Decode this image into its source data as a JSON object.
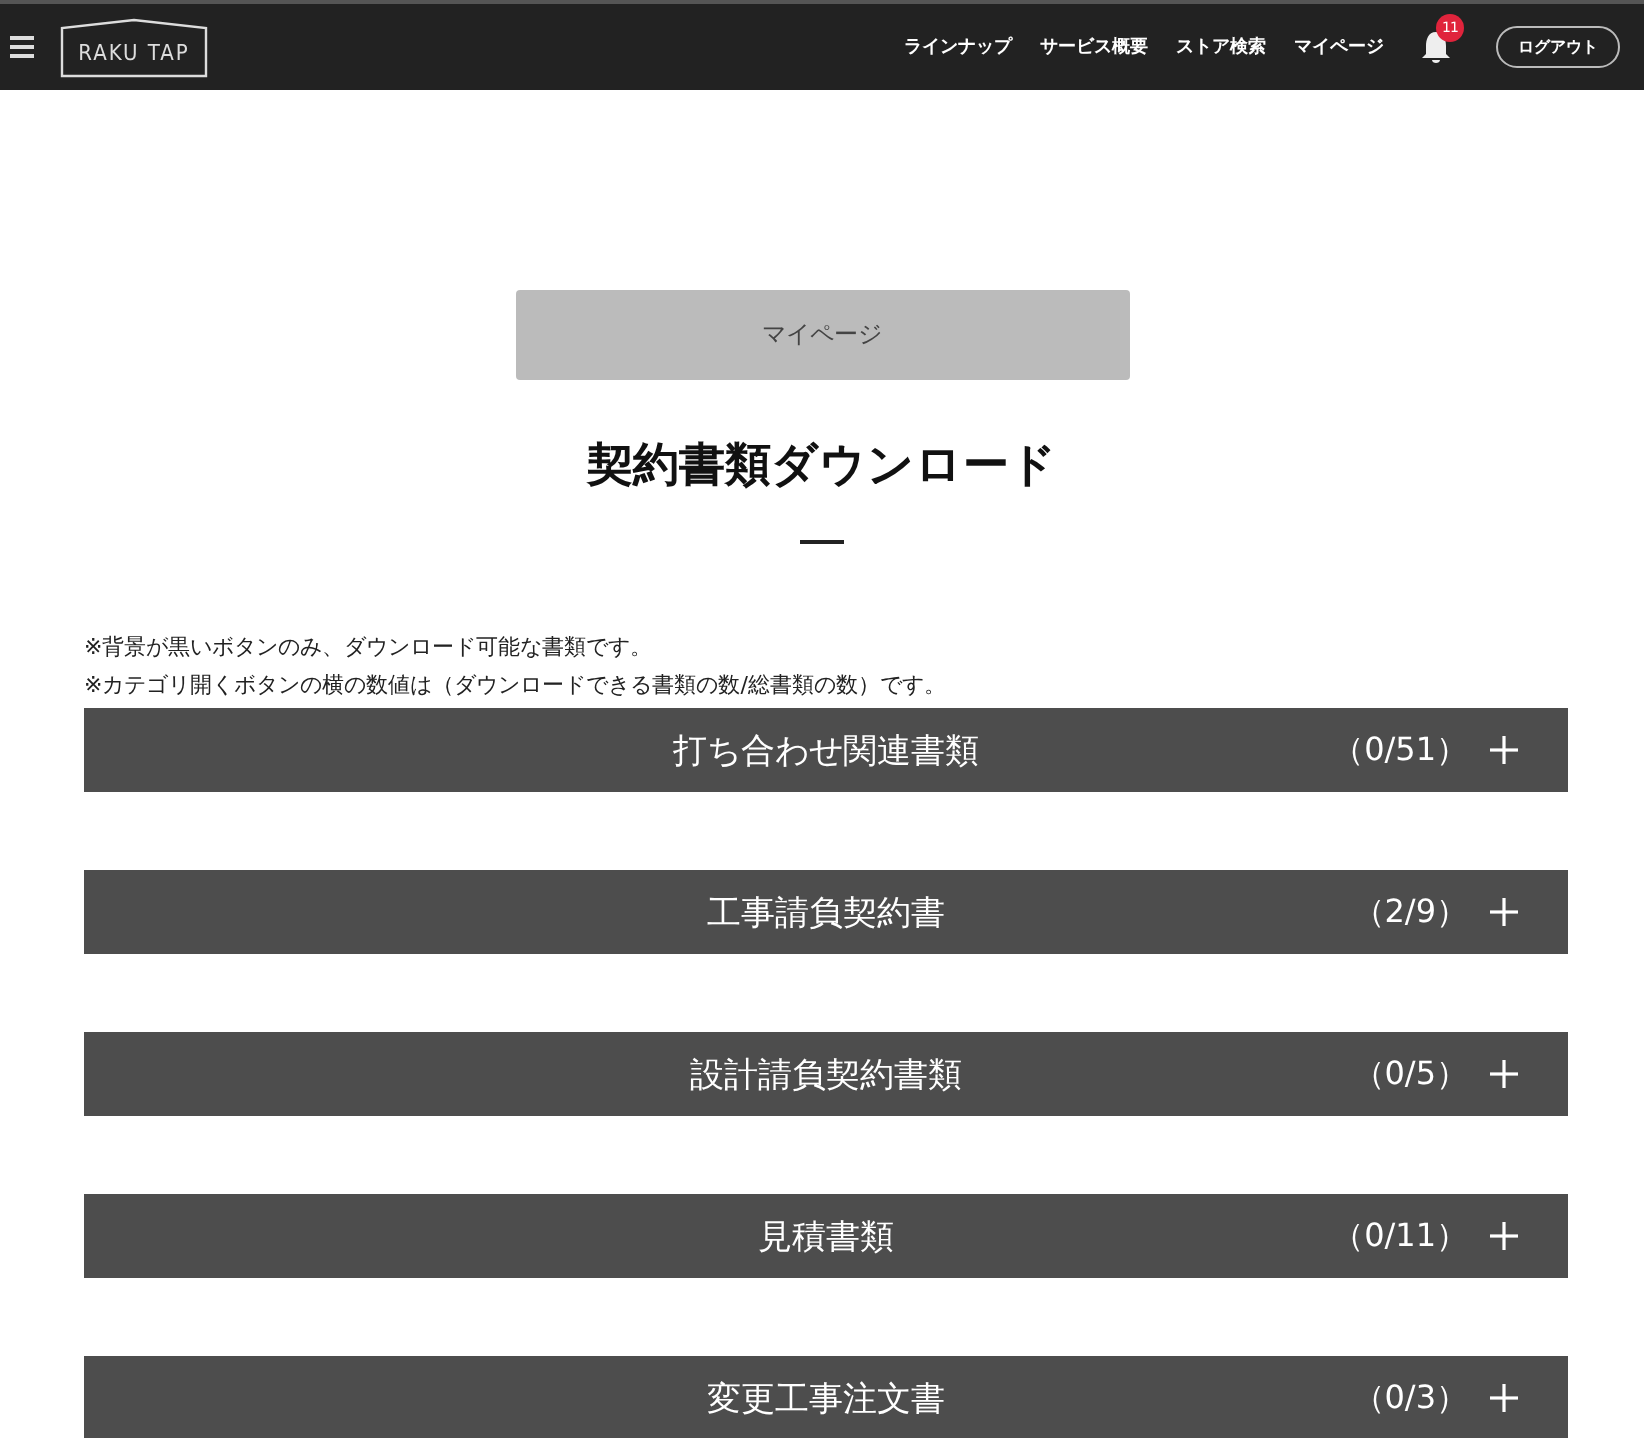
{
  "header": {
    "logo": "RAKU TAP",
    "nav": [
      "ラインナップ",
      "サービス概要",
      "ストア検索",
      "マイページ"
    ],
    "notification_count": "11",
    "logout": "ログアウト"
  },
  "breadcrumb_button": "マイページ",
  "title": "契約書類ダウンロード",
  "notes": [
    "※背景が黒いボタンのみ、ダウンロード可能な書類です。",
    "※カテゴリ開くボタンの横の数値は（ダウンロードできる書類の数/総書類の数）です。"
  ],
  "categories": [
    {
      "label": "打ち合わせ関連書類",
      "count": "（0/51）",
      "expanded": false
    },
    {
      "label": "工事請負契約書",
      "count": "（2/9）",
      "expanded": false
    },
    {
      "label": "設計請負契約書類",
      "count": "（0/5）",
      "expanded": false
    },
    {
      "label": "見積書類",
      "count": "（0/11）",
      "expanded": false
    },
    {
      "label": "変更工事注文書",
      "count": "（0/3）",
      "expanded": false
    }
  ]
}
